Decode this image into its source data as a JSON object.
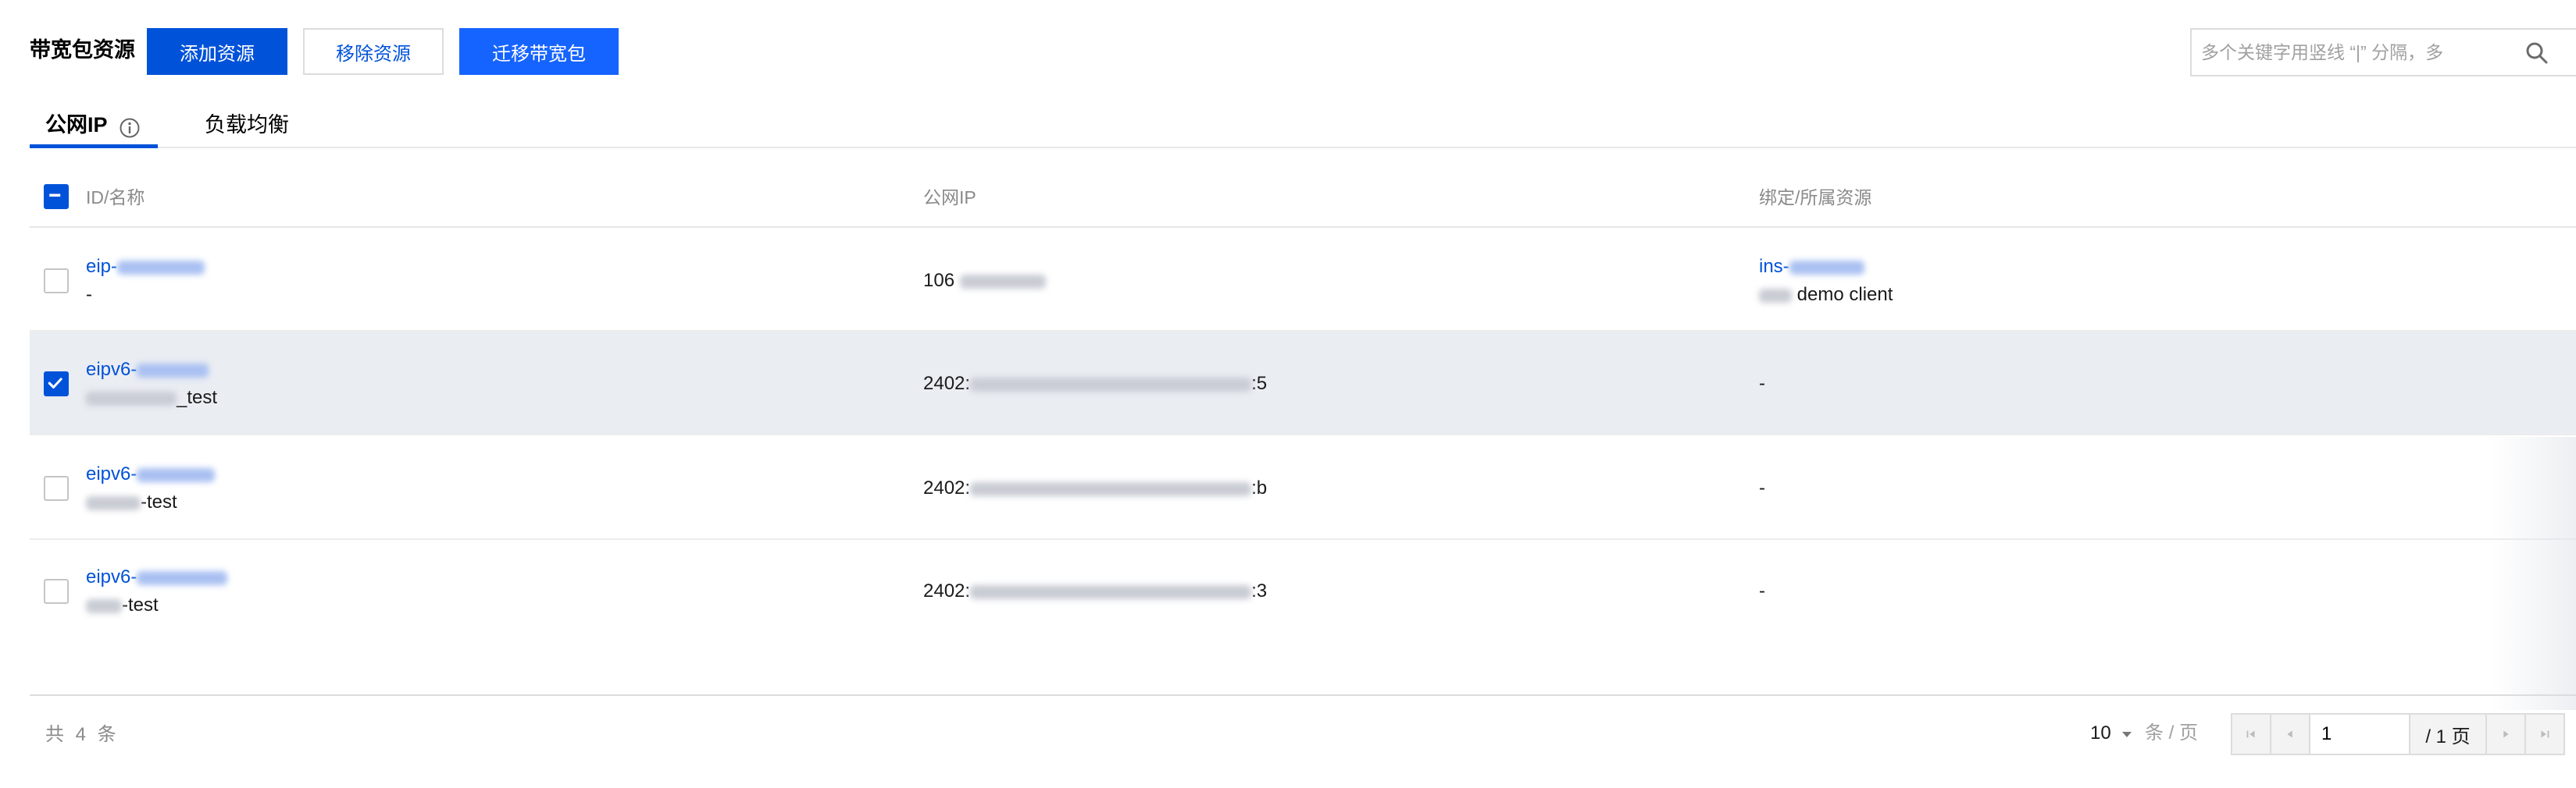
{
  "toolbar": {
    "title": "带宽包资源",
    "add_label": "添加资源",
    "remove_label": "移除资源",
    "migrate_label": "迁移带宽包"
  },
  "search": {
    "placeholder": "多个关键字用竖线 “|” 分隔，多"
  },
  "tabs": [
    {
      "label": "公网IP",
      "active": true
    },
    {
      "label": "负载均衡",
      "active": false
    }
  ],
  "table": {
    "headers": [
      "ID/名称",
      "公网IP",
      "绑定/所属资源"
    ],
    "rows": [
      {
        "id_prefix": "eip-",
        "name_prefix": "",
        "name_suffix": "-",
        "ip_prefix": "106",
        "ip_suffix": "",
        "res_prefix": "ins-",
        "res_suffix": "demo client",
        "checked": false
      },
      {
        "id_prefix": "eipv6-",
        "name_prefix": "",
        "name_suffix": "_test",
        "ip_prefix": "2402:",
        "ip_suffix": ":5",
        "res_prefix": "",
        "res_suffix": "-",
        "checked": true
      },
      {
        "id_prefix": "eipv6-",
        "name_prefix": "",
        "name_suffix": "-test",
        "ip_prefix": "2402:",
        "ip_suffix": ":b",
        "res_prefix": "",
        "res_suffix": "-",
        "checked": false
      },
      {
        "id_prefix": "eipv6-",
        "name_prefix": "",
        "name_suffix": "-test",
        "ip_prefix": "2402:",
        "ip_suffix": ":3",
        "res_prefix": "",
        "res_suffix": "-",
        "checked": false
      }
    ]
  },
  "pagination": {
    "total_text": "共 4 条",
    "page_size": "10",
    "per_page_label": "条 / 页",
    "current_page": "1",
    "total_pages_label": "/ 1 页"
  },
  "colors": {
    "accent": "#0052d9",
    "selected_row": "#eaedf2"
  },
  "icons": [
    "search-icon",
    "info-icon",
    "chevron-down-icon",
    "first-page-icon",
    "prev-page-icon",
    "next-page-icon",
    "last-page-icon",
    "checkbox-checked-icon",
    "checkbox-partial-icon"
  ]
}
